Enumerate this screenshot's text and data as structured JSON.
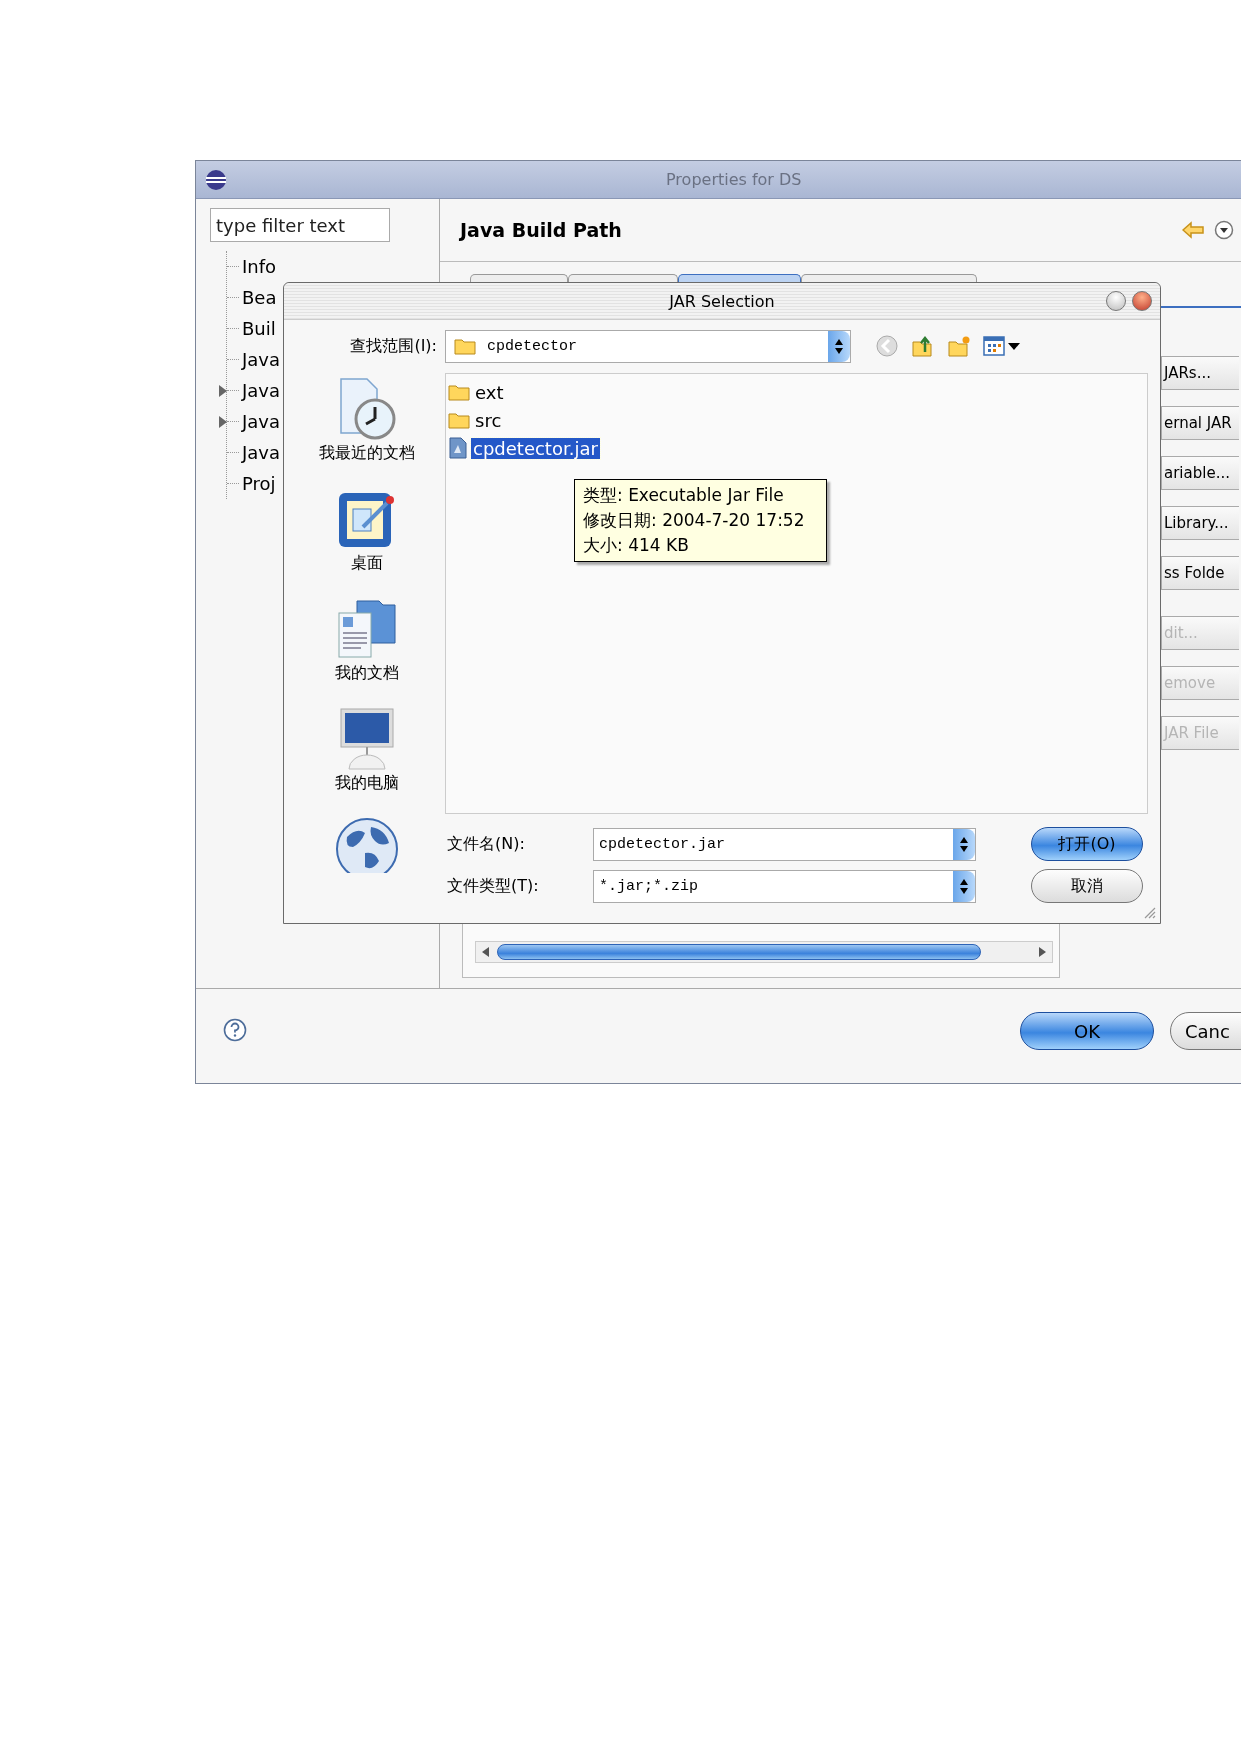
{
  "window": {
    "title": "Properties for DS"
  },
  "filter": {
    "placeholder": "type filter text"
  },
  "tree": [
    {
      "label": "Info",
      "expandable": false
    },
    {
      "label": "Bea",
      "expandable": false
    },
    {
      "label": "Buil",
      "expandable": false
    },
    {
      "label": "Java",
      "expandable": false
    },
    {
      "label": "Java",
      "expandable": true
    },
    {
      "label": "Java",
      "expandable": true
    },
    {
      "label": "Java",
      "expandable": false
    },
    {
      "label": "Proj",
      "expandable": false
    }
  ],
  "page": {
    "title": "Java Build Path"
  },
  "tabs": [
    {
      "selected": false
    },
    {
      "selected": false
    },
    {
      "selected": true
    },
    {
      "selected": false
    }
  ],
  "side_buttons": [
    {
      "label": "JARs...",
      "disabled": false
    },
    {
      "label": "ernal JAR",
      "disabled": false
    },
    {
      "label": "ariable...",
      "disabled": false
    },
    {
      "label": "Library...",
      "disabled": false
    },
    {
      "label": "ss Folde",
      "disabled": false
    },
    {
      "label": "dit...",
      "disabled": true
    },
    {
      "label": "emove",
      "disabled": true
    },
    {
      "label": "JAR File",
      "disabled": true
    }
  ],
  "buttons": [
    {
      "label": "OK",
      "default": true
    },
    {
      "label": "Canc",
      "default": false
    }
  ],
  "dialog": {
    "title": "JAR Selection",
    "look_in": {
      "label": "查找范围(I):",
      "value": "cpdetector"
    },
    "places": [
      {
        "kind": "recent",
        "label": "我最近的文档"
      },
      {
        "kind": "desktop",
        "label": "桌面"
      },
      {
        "kind": "documents",
        "label": "我的文档"
      },
      {
        "kind": "computer",
        "label": "我的电脑"
      },
      {
        "kind": "network"
      }
    ],
    "files": [
      {
        "name": "ext",
        "kind": "folder",
        "selected": false
      },
      {
        "name": "src",
        "kind": "folder",
        "selected": false
      },
      {
        "name": "cpdetector.jar",
        "kind": "jar",
        "selected": true
      }
    ],
    "tooltip": [
      "类型: Executable Jar File",
      "修改日期: 2004-7-20 17:52",
      "大小: 414 KB"
    ],
    "file_name": {
      "label": "文件名(N):",
      "value": "cpdetector.jar"
    },
    "file_type": {
      "label": "文件类型(T):",
      "value": "*.jar;*.zip"
    },
    "buttons": [
      {
        "label": "打开(O)",
        "default": true
      },
      {
        "label": "取消",
        "default": false
      }
    ]
  }
}
